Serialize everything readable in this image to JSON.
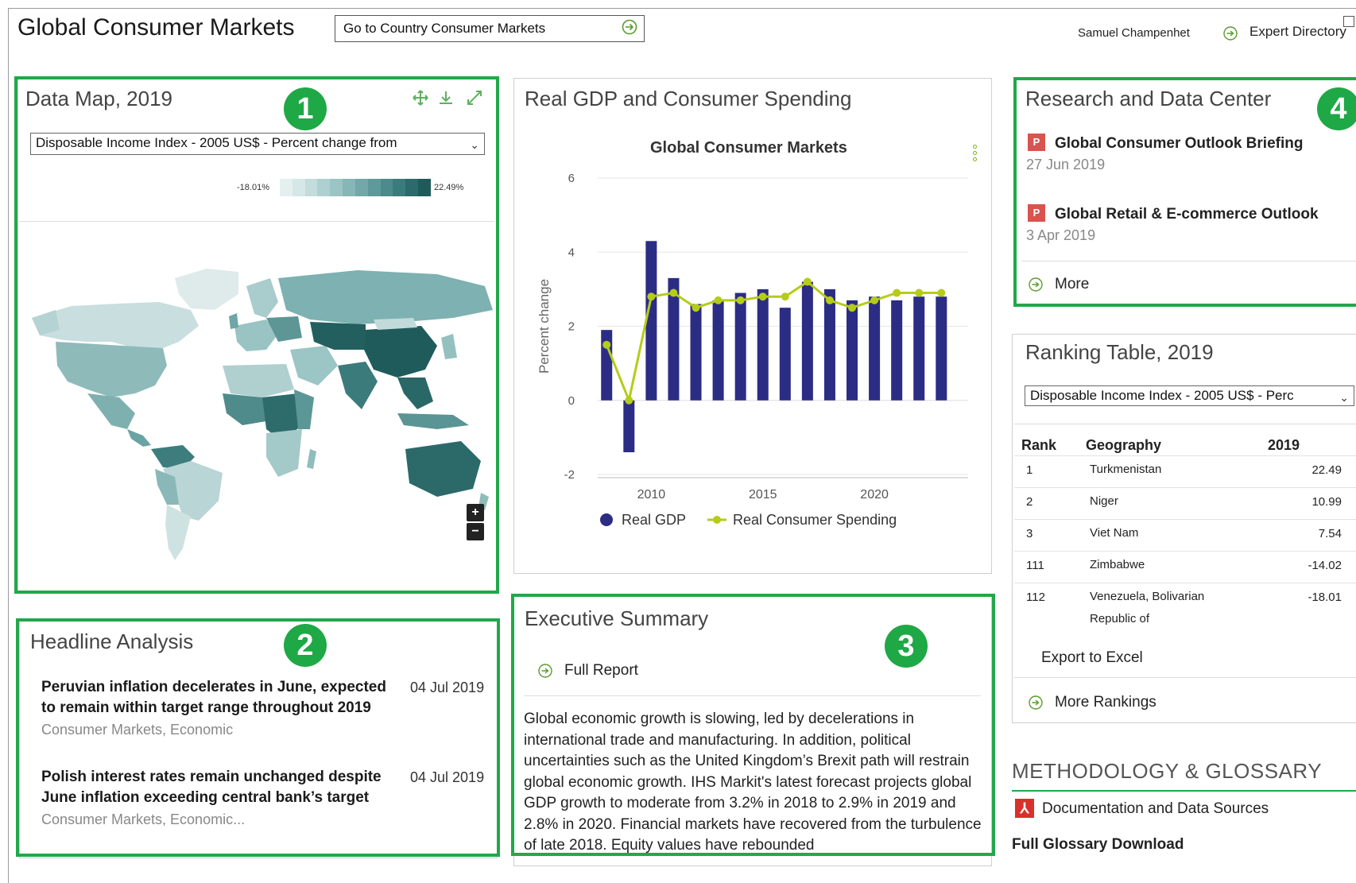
{
  "header": {
    "title": "Global Consumer Markets",
    "goto_label": "Go to Country Consumer Markets",
    "user_name": "Samuel Champenhet",
    "expert_link": "Expert Directory"
  },
  "badges": [
    "1",
    "2",
    "3",
    "4"
  ],
  "data_map": {
    "title": "Data Map, 2019",
    "select_value": "Disposable Income Index - 2005 US$ - Percent change from",
    "legend_min": "-18.01%",
    "legend_max": "22.49%",
    "legend_colors": [
      "#e4efef",
      "#d5e7e7",
      "#c3dcdc",
      "#afd0d0",
      "#9bc4c4",
      "#86b6b6",
      "#72a8a8",
      "#5e9a9a",
      "#4c8b8b",
      "#3a7b7b",
      "#2c6b6b",
      "#1f5b5b"
    ],
    "icons": [
      "move-icon",
      "download-icon",
      "expand-icon"
    ],
    "zoom_in": "+",
    "zoom_out": "−"
  },
  "headline": {
    "title": "Headline Analysis",
    "items": [
      {
        "title": "Peruvian inflation decelerates in June, expected to remain within target range throughout 2019",
        "date": "04 Jul 2019",
        "tags": "Consumer Markets, Economic"
      },
      {
        "title": "Polish interest rates remain unchanged despite June inflation exceeding central bank’s target",
        "date": "04 Jul 2019",
        "tags": "Consumer Markets, Economic..."
      }
    ]
  },
  "gdp_panel": {
    "title": "Real GDP and Consumer Spending"
  },
  "chart_data": {
    "type": "bar",
    "title": "Global Consumer Markets",
    "xlabel": "",
    "ylabel": "Percent change",
    "ylim": [
      -2,
      6
    ],
    "yticks": [
      -2,
      0,
      2,
      4,
      6
    ],
    "xticks": [
      2010,
      2015,
      2020
    ],
    "x": [
      2008,
      2009,
      2010,
      2011,
      2012,
      2013,
      2014,
      2015,
      2016,
      2017,
      2018,
      2019,
      2020,
      2021,
      2022,
      2023
    ],
    "series": [
      {
        "name": "Real GDP",
        "type": "bar",
        "color": "#2b2c84",
        "values": [
          1.9,
          -1.4,
          4.3,
          3.3,
          2.6,
          2.7,
          2.9,
          3.0,
          2.5,
          3.2,
          3.0,
          2.7,
          2.8,
          2.7,
          2.8,
          2.8
        ]
      },
      {
        "name": "Real Consumer Spending",
        "type": "line",
        "color": "#b5cc18",
        "values": [
          1.5,
          0.0,
          2.8,
          2.9,
          2.5,
          2.7,
          2.7,
          2.8,
          2.8,
          3.2,
          2.7,
          2.5,
          2.7,
          2.9,
          2.9,
          2.9
        ]
      }
    ],
    "grid": true,
    "legend": "bottom"
  },
  "exec_summary": {
    "title": "Executive Summary",
    "full_report": "Full Report",
    "body": "Global economic growth is slowing, led by decelerations in international trade and manufacturing. In addition, political uncertainties such as the United Kingdom’s Brexit path will restrain global economic growth. IHS Markit's latest forecast projects global GDP growth to moderate from 3.2% in 2018 to 2.9% in 2019 and 2.8% in 2020. Financial markets have recovered from the turbulence of late 2018. Equity values have rebounded"
  },
  "research": {
    "title": "Research and Data Center",
    "items": [
      {
        "icon": "P",
        "title": "Global Consumer Outlook Briefing",
        "date": "27 Jun 2019"
      },
      {
        "icon": "P",
        "title": "Global Retail & E-commerce Outlook",
        "date": "3 Apr 2019"
      }
    ],
    "more": "More"
  },
  "ranking": {
    "title": "Ranking Table, 2019",
    "select_value": "Disposable Income Index - 2005 US$ - Perc",
    "headers": [
      "Rank",
      "Geography",
      "2019"
    ],
    "rows": [
      {
        "rank": "1",
        "geo": "Turkmenistan",
        "val": "22.49"
      },
      {
        "rank": "2",
        "geo": "Niger",
        "val": "10.99"
      },
      {
        "rank": "3",
        "geo": "Viet Nam",
        "val": "7.54"
      },
      {
        "rank": "111",
        "geo": "Zimbabwe",
        "val": "-14.02"
      },
      {
        "rank": "112",
        "geo": "Venezuela, Bolivarian Republic of",
        "val": "-18.01"
      }
    ],
    "export": "Export to Excel",
    "more_rankings": "More Rankings"
  },
  "methodology": {
    "title": "METHODOLOGY & GLOSSARY",
    "doc_link": "Documentation and Data Sources",
    "glossary": "Full Glossary Download"
  },
  "colors": {
    "accent_green": "#21a84a",
    "bar_navy": "#2b2c84",
    "line_lime": "#b5cc18",
    "map_dark": "#1f5b5b"
  }
}
